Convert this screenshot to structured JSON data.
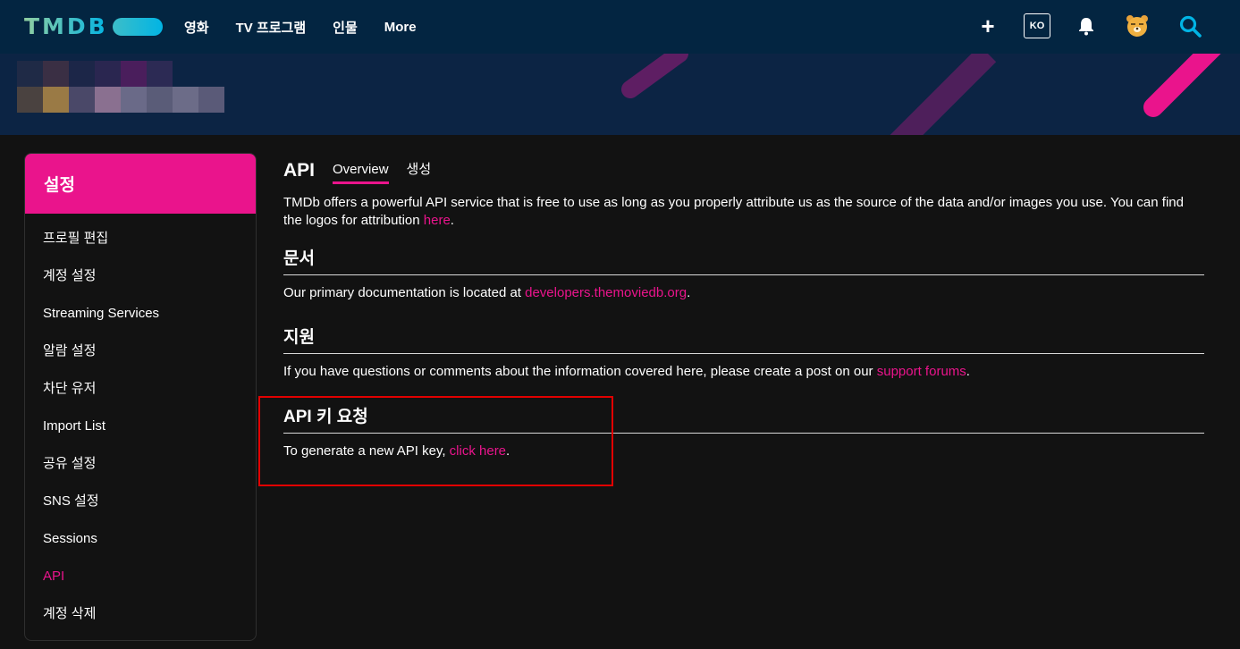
{
  "nav": {
    "logo": "TMDB",
    "menu": [
      "영화",
      "TV 프로그램",
      "인물",
      "More"
    ],
    "language": "KO",
    "icons": [
      "plus-icon",
      "bell-icon",
      "avatar-icon",
      "search-icon"
    ]
  },
  "sidebar": {
    "title": "설정",
    "items": [
      {
        "label": "프로필 편집"
      },
      {
        "label": "계정 설정"
      },
      {
        "label": "Streaming Services"
      },
      {
        "label": "알람 설정"
      },
      {
        "label": "차단 유저"
      },
      {
        "label": "Import List"
      },
      {
        "label": "공유 설정"
      },
      {
        "label": "SNS 설정"
      },
      {
        "label": "Sessions"
      },
      {
        "label": "API",
        "active": true
      },
      {
        "label": "계정 삭제"
      }
    ]
  },
  "main": {
    "title": "API",
    "tabs": [
      {
        "label": "Overview",
        "active": true
      },
      {
        "label": "생성"
      }
    ],
    "intro": {
      "text": "TMDb offers a powerful API service that is free to use as long as you properly attribute us as the source of the data and/or images you use. You can find the logos for attribution ",
      "link": "here",
      "after": "."
    },
    "sections": [
      {
        "heading": "문서",
        "text": "Our primary documentation is located at ",
        "link": "developers.themoviedb.org",
        "after": "."
      },
      {
        "heading": "지원",
        "text": "If you have questions or comments about the information covered here, please create a post on our ",
        "link": "support forums",
        "after": "."
      },
      {
        "heading": "API 키 요청",
        "text": "To generate a new API key, ",
        "link": "click here",
        "after": "."
      }
    ]
  },
  "colors": {
    "nav_bg": "#032541",
    "accent": "#ea148c",
    "page_bg": "#121212",
    "highlight": "#e10000"
  }
}
